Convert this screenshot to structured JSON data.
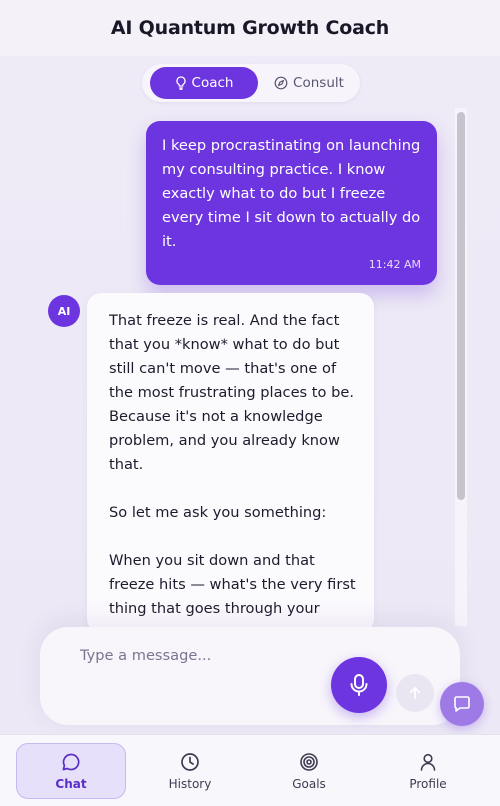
{
  "header": {
    "title": "AI Quantum Growth Coach"
  },
  "mode_toggle": {
    "options": [
      {
        "label": "Coach",
        "icon": "lightbulb-icon",
        "active": true
      },
      {
        "label": "Consult",
        "icon": "compass-icon",
        "active": false
      }
    ]
  },
  "messages": {
    "user": {
      "text": "I keep procrastinating on launching my consulting practice. I know exactly what to do but I freeze every time I sit down to actually do it.",
      "time": "11:42 AM"
    },
    "ai": {
      "avatar": "AI",
      "paragraphs": [
        "That freeze is real. And the fact that you *know* what to do but still can't move — that's one of the most frustrating places to be. Because it's not a knowledge problem, and you already know that.",
        "So let me ask you something:",
        "When you sit down and that freeze hits — what's the very first thing that goes through your"
      ]
    }
  },
  "composer": {
    "placeholder": "Type a message...",
    "mic_icon": "microphone-icon",
    "send_icon": "arrow-up-icon",
    "fab_icon": "chat-bubble-icon"
  },
  "nav": {
    "items": [
      {
        "label": "Chat",
        "icon": "chat-bubble-icon",
        "active": true
      },
      {
        "label": "History",
        "icon": "clock-icon",
        "active": false
      },
      {
        "label": "Goals",
        "icon": "target-icon",
        "active": false
      },
      {
        "label": "Profile",
        "icon": "user-icon",
        "active": false
      }
    ]
  },
  "colors": {
    "accent": "#6d35e0",
    "accent_light": "#9d7ae6",
    "background": "#eeeaf6"
  }
}
